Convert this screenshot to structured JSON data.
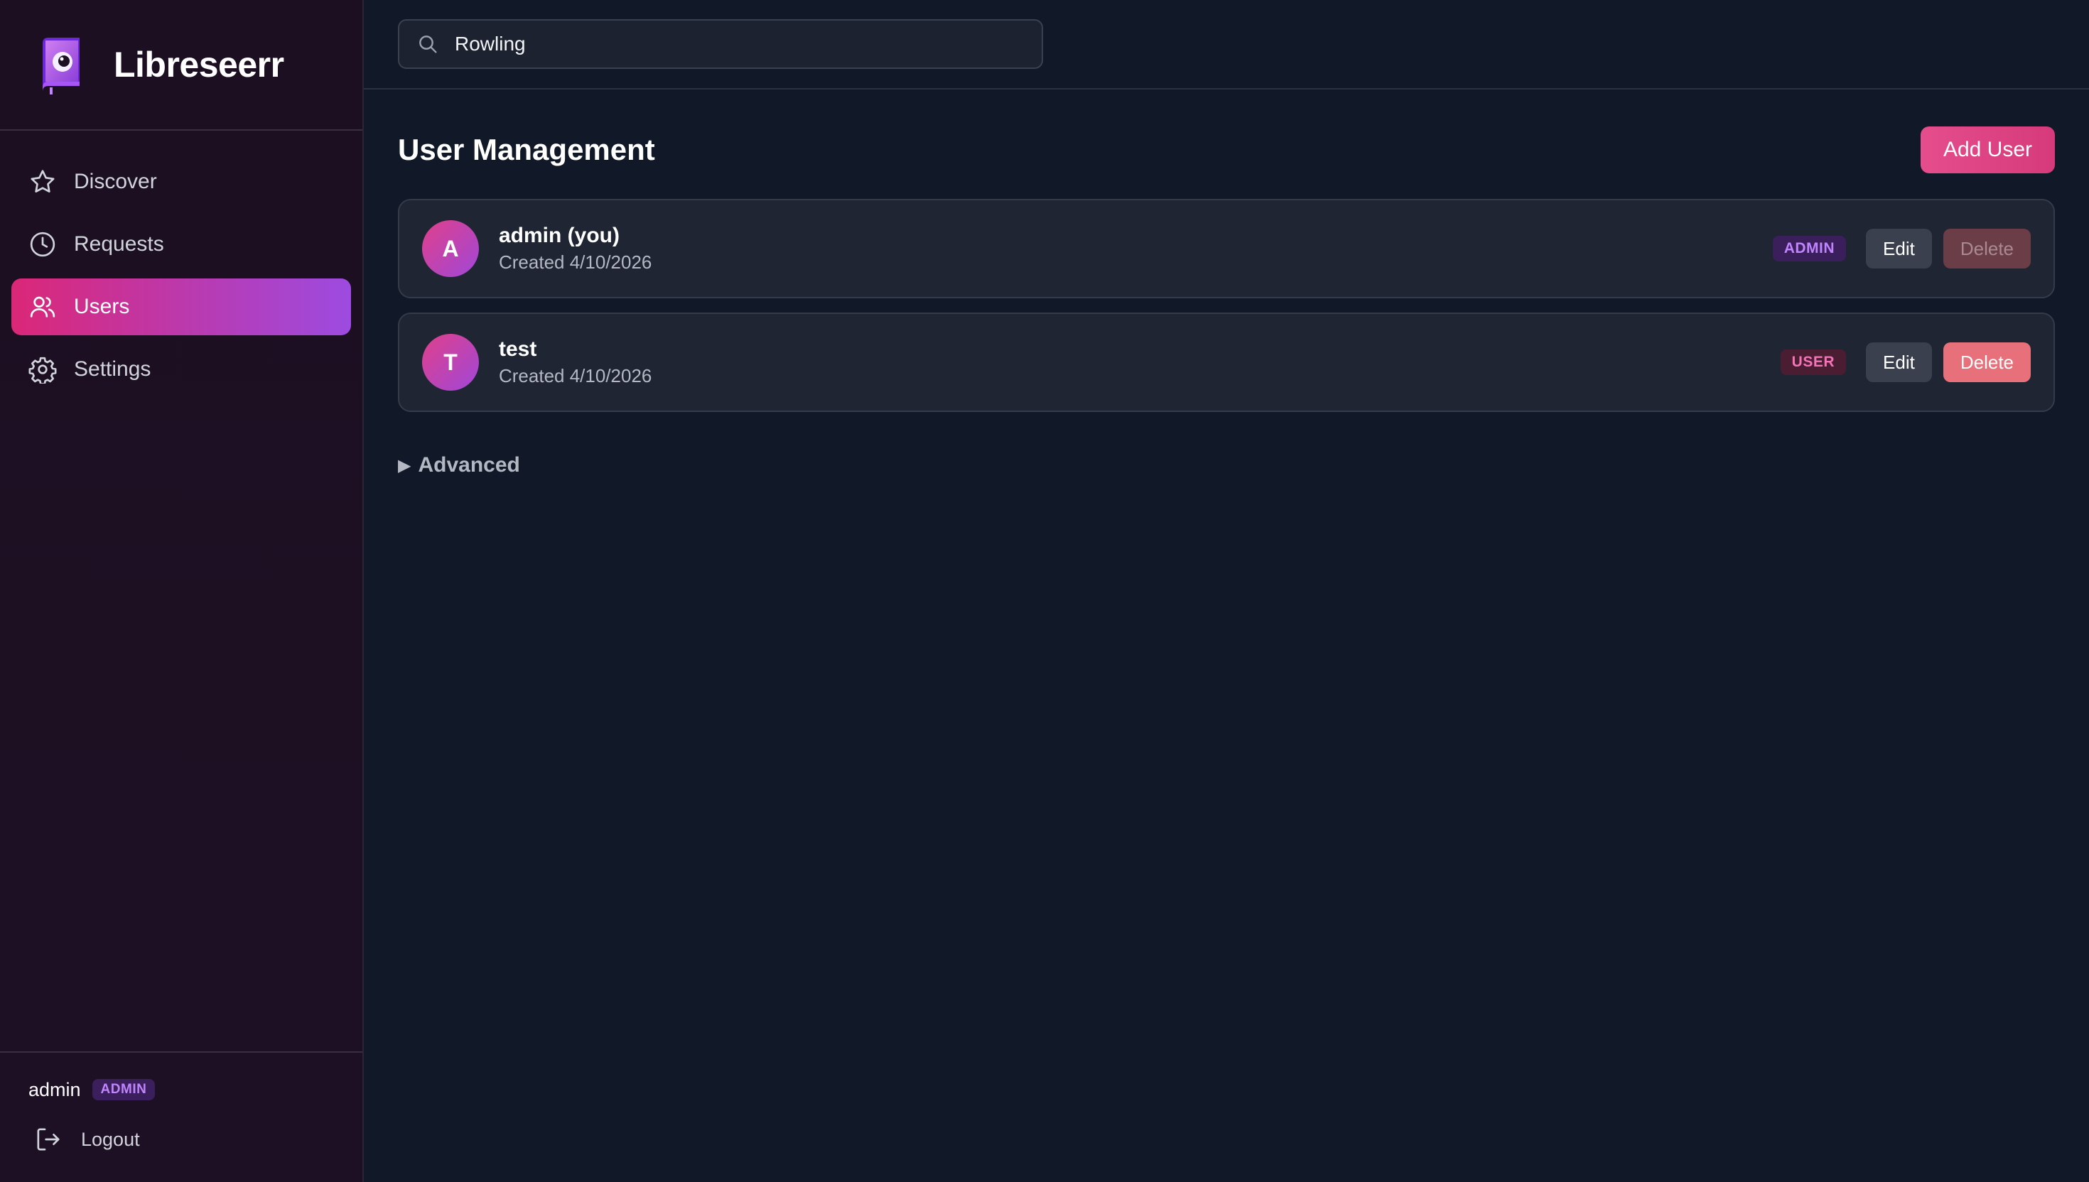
{
  "app": {
    "name": "Libreseerr",
    "accent": "#db2777",
    "accent_secondary": "#9d4be0"
  },
  "sidebar": {
    "items": [
      {
        "label": "Discover",
        "icon": "star-icon",
        "active": false
      },
      {
        "label": "Requests",
        "icon": "clock-icon",
        "active": false
      },
      {
        "label": "Users",
        "icon": "users-icon",
        "active": true
      },
      {
        "label": "Settings",
        "icon": "gear-icon",
        "active": false
      }
    ],
    "footer": {
      "username": "admin",
      "role_badge": "ADMIN",
      "logout_label": "Logout"
    }
  },
  "search": {
    "value": "Rowling",
    "icon": "search-icon"
  },
  "main": {
    "title": "User Management",
    "add_user_label": "Add User",
    "users": [
      {
        "initial": "A",
        "name": "admin (you)",
        "created": "Created 4/10/2026",
        "role": "ADMIN",
        "edit_label": "Edit",
        "delete_label": "Delete",
        "delete_disabled": true
      },
      {
        "initial": "T",
        "name": "test",
        "created": "Created 4/10/2026",
        "role": "USER",
        "edit_label": "Edit",
        "delete_label": "Delete",
        "delete_disabled": false
      }
    ],
    "advanced_label": "Advanced"
  }
}
